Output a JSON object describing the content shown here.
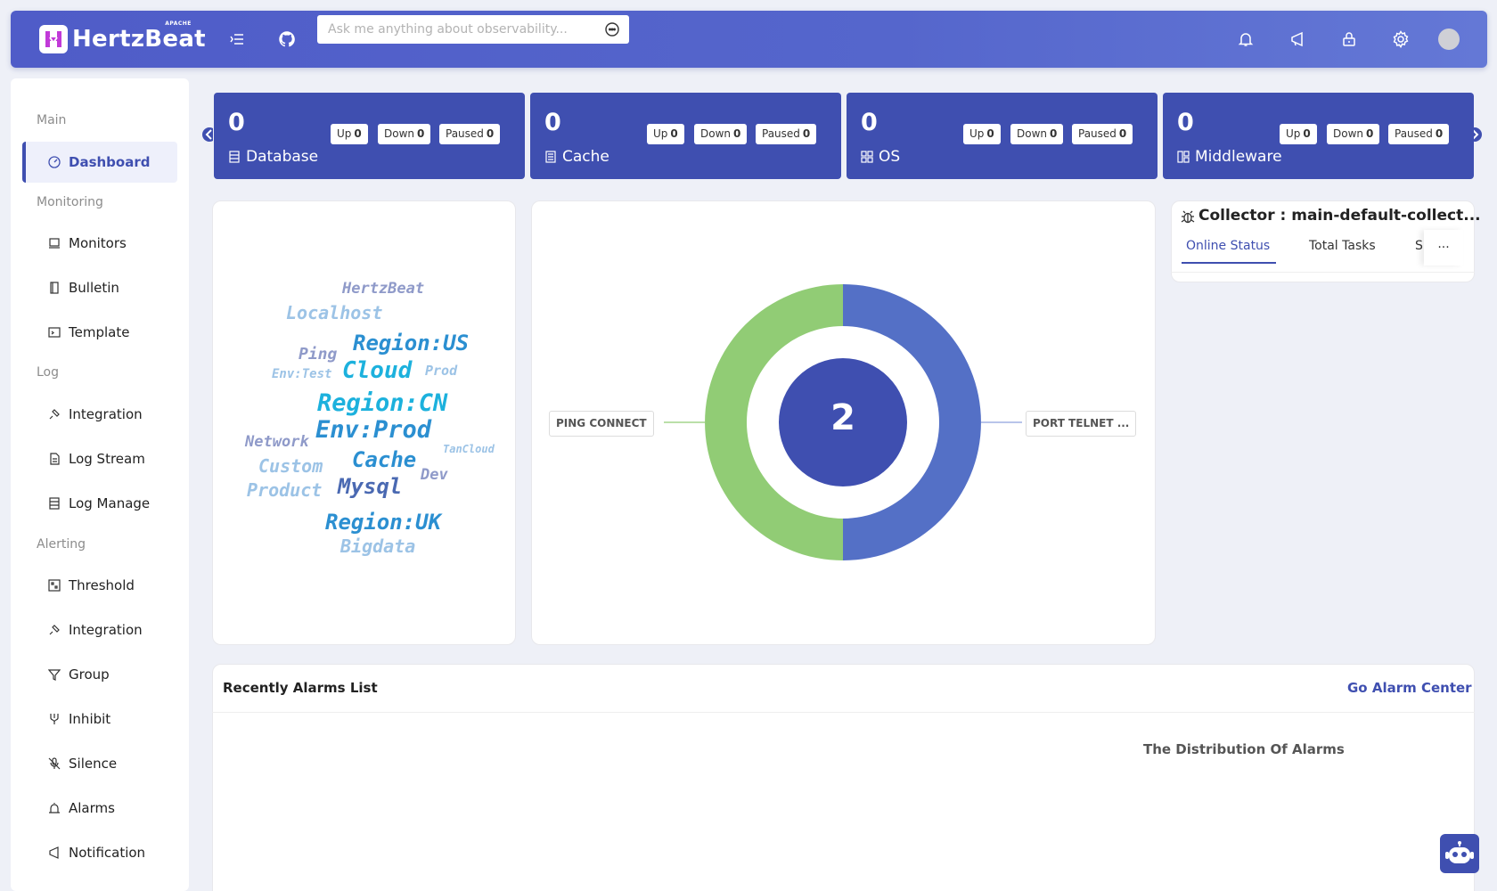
{
  "brand": {
    "name": "HertzBeat",
    "badge": "APACHE"
  },
  "header": {
    "search_placeholder": "Ask me anything about observability...",
    "icons": [
      "menu-fold-icon",
      "github-icon",
      "robot-chat-icon",
      "bell-icon",
      "announcement-icon",
      "lock-icon",
      "gear-icon",
      "avatar"
    ]
  },
  "sidebar": {
    "groups": {
      "main": "Main",
      "monitoring": "Monitoring",
      "log": "Log",
      "alerting": "Alerting"
    },
    "items": {
      "dashboard": "Dashboard",
      "monitors": "Monitors",
      "bulletin": "Bulletin",
      "template": "Template",
      "log_integration": "Integration",
      "log_stream": "Log Stream",
      "log_manage": "Log Manage",
      "threshold": "Threshold",
      "alert_integration": "Integration",
      "group": "Group",
      "inhibit": "Inhibit",
      "silence": "Silence",
      "alarms": "Alarms",
      "notification": "Notification"
    }
  },
  "cards": [
    {
      "label": "Database",
      "total": "0",
      "up_label": "Up",
      "up": "0",
      "down_label": "Down",
      "down": "0",
      "paused_label": "Paused",
      "paused": "0",
      "icon": "database-icon"
    },
    {
      "label": "Cache",
      "total": "0",
      "up_label": "Up",
      "up": "0",
      "down_label": "Down",
      "down": "0",
      "paused_label": "Paused",
      "paused": "0",
      "icon": "cache-icon"
    },
    {
      "label": "OS",
      "total": "0",
      "up_label": "Up",
      "up": "0",
      "down_label": "Down",
      "down": "0",
      "paused_label": "Paused",
      "paused": "0",
      "icon": "os-icon"
    },
    {
      "label": "Middleware",
      "total": "0",
      "up_label": "Up",
      "up": "0",
      "down_label": "Down",
      "down": "0",
      "paused_label": "Paused",
      "paused": "0",
      "icon": "middleware-icon"
    }
  ],
  "word_cloud": [
    "HertzBeat",
    "Localhost",
    "Region:US",
    "Ping",
    "Env:Test",
    "Cloud",
    "Prod",
    "Region:CN",
    "Env:Prod",
    "Network",
    "TanCloud",
    "Custom",
    "Cache",
    "Dev",
    "Product",
    "Mysql",
    "Region:UK",
    "Bigdata"
  ],
  "donut": {
    "center_value": "2",
    "segments": [
      {
        "name": "PING CONNECT",
        "value": 1,
        "color": "#91cc75"
      },
      {
        "name": "PORT TELNET ...",
        "value": 1,
        "color": "#5470c6"
      }
    ]
  },
  "collector": {
    "title": "Collector : main-default-collect...",
    "tabs": [
      "Online Status",
      "Total Tasks",
      "S"
    ],
    "more": "···"
  },
  "alarms": {
    "title": "Recently Alarms List",
    "link": "Go Alarm Center",
    "distribution_title": "The Distribution Of Alarms"
  },
  "colors": {
    "primary": "#3f4fb0",
    "header": "#5566cc"
  }
}
